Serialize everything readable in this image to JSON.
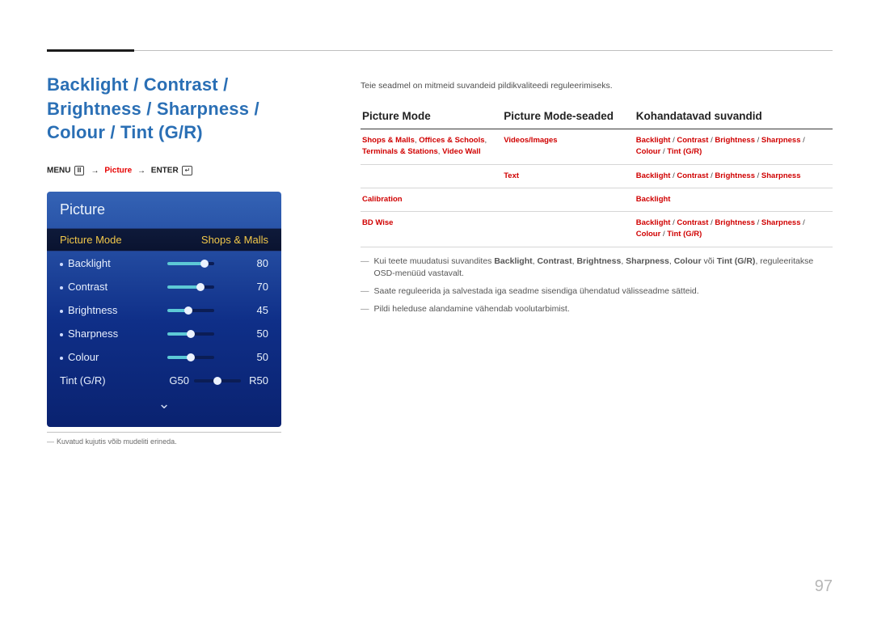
{
  "heading": "Backlight / Contrast / Brightness / Sharpness / Colour / Tint (G/R)",
  "menu_path": {
    "menu": "MENU",
    "picture": "Picture",
    "enter": "ENTER"
  },
  "panel": {
    "title": "Picture",
    "mode_row": {
      "label": "Picture Mode",
      "value": "Shops & Malls"
    },
    "rows": [
      {
        "name": "Backlight",
        "value": "80",
        "pct": 80
      },
      {
        "name": "Contrast",
        "value": "70",
        "pct": 70
      },
      {
        "name": "Brightness",
        "value": "45",
        "pct": 45
      },
      {
        "name": "Sharpness",
        "value": "50",
        "pct": 50
      },
      {
        "name": "Colour",
        "value": "50",
        "pct": 50
      }
    ],
    "tint": {
      "name": "Tint (G/R)",
      "left": "G50",
      "right": "R50"
    }
  },
  "footnote": "Kuvatud kujutis võib mudeliti erineda.",
  "intro": "Teie seadmel on mitmeid suvandeid pildikvaliteedi reguleerimiseks.",
  "table": {
    "headers": [
      "Picture Mode",
      "Picture Mode-seaded",
      "Kohandatavad suvandid"
    ],
    "rows": [
      {
        "col1_parts": [
          "Shops & Malls",
          ", ",
          "Offices & Schools",
          ", ",
          "Terminals & Stations",
          ", ",
          "Video Wall"
        ],
        "col2": "Videos/Images",
        "col3_parts": [
          "Backlight",
          " / ",
          "Contrast",
          " / ",
          "Brightness",
          " / ",
          "Sharpness",
          " / ",
          "Colour",
          " / ",
          "Tint (G/R)"
        ]
      },
      {
        "col1_parts": [
          ""
        ],
        "col2": "Text",
        "col3_parts": [
          "Backlight",
          " / ",
          "Contrast",
          " / ",
          "Brightness",
          " / ",
          "Sharpness"
        ]
      },
      {
        "col1_parts": [
          "Calibration"
        ],
        "col2": "",
        "col3_parts": [
          "Backlight"
        ]
      },
      {
        "col1_parts": [
          "BD Wise"
        ],
        "col2": "",
        "col3_parts": [
          "Backlight",
          " / ",
          "Contrast",
          " / ",
          "Brightness",
          " / ",
          "Sharpness",
          " / ",
          "Colour",
          " / ",
          "Tint (G/R)"
        ]
      }
    ]
  },
  "notes": [
    {
      "pre": "Kui teete muudatusi suvandites ",
      "bolds": [
        "Backlight",
        "Contrast",
        "Brightness",
        "Sharpness",
        "Colour"
      ],
      "mid": " või ",
      "last_bold": "Tint (G/R)",
      "post": ", reguleeritakse OSD-menüüd vastavalt."
    },
    {
      "plain": "Saate reguleerida ja salvestada iga seadme sisendiga ühendatud välisseadme sätteid."
    },
    {
      "plain": "Pildi heleduse alandamine vähendab voolutarbimist."
    }
  ],
  "page_number": "97"
}
